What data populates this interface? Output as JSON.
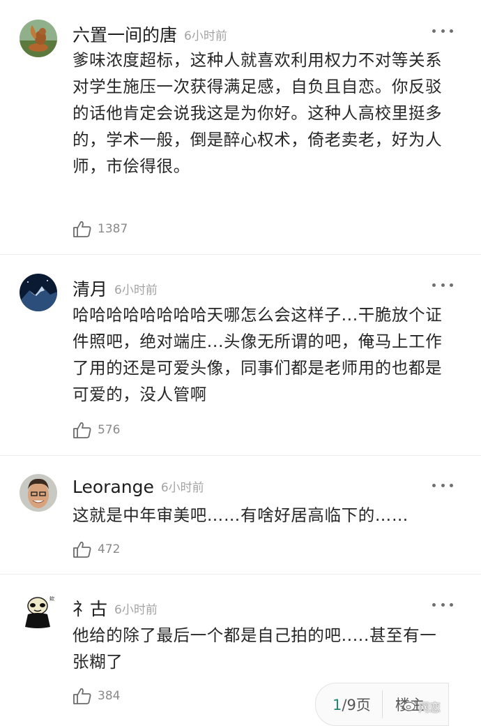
{
  "comments": [
    {
      "username": "六置一间的唐",
      "time": "6小时前",
      "text": "爹味浓度超标，这种人就喜欢利用权力不对等关系对学生施压一次获得满足感，自负且自恋。你反驳的话他肯定会说我这是为你好。这种人高校里挺多的，学术一般，倒是醉心权术，倚老卖老，好为人师，市侩得很。",
      "likes": "1387",
      "avatar": "squirrel-photo"
    },
    {
      "username": "清月",
      "time": "6小时前",
      "text": "哈哈哈哈哈哈哈哈天哪怎么会这样子...干脆放个证件照吧，绝对端庄...头像无所谓的吧，俺马上工作了用的还是可爱头像，同事们都是老师用的也都是可爱的，没人管啊",
      "likes": "576",
      "avatar": "night-mountain-photo"
    },
    {
      "username": "Leorange",
      "time": "6小时前",
      "text": "这就是中年审美吧……有啥好居高临下的……",
      "likes": "472",
      "avatar": "smiling-man-photo"
    },
    {
      "username": "礻古",
      "time": "6小时前",
      "text": "他给的除了最后一个都是自己拍的吧.....甚至有一张糊了",
      "likes": "384",
      "avatar": "panda-meme"
    }
  ],
  "pager": {
    "current": "1",
    "total_text": "/9页",
    "floor_label": "楼主"
  },
  "watermark": "网恋",
  "colors": {
    "accent": "#1f8a6e",
    "time": "#a3a3a3",
    "text": "#262626"
  }
}
